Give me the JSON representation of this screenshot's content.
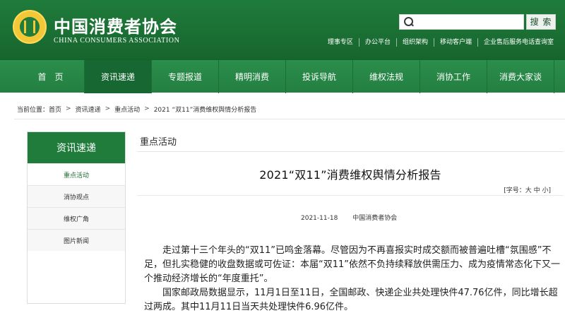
{
  "site": {
    "title": "中国消费者协会",
    "subtitle": "CHINA CONSUMERS ASSOCIATION"
  },
  "search": {
    "placeholder": "",
    "button_label": "搜 索"
  },
  "toplinks": [
    "理事专区",
    "办公平台",
    "组织架构",
    "移动客户端",
    "企业售后服务电话查询室"
  ],
  "nav": [
    {
      "label": "首　页",
      "active": false
    },
    {
      "label": "资讯速递",
      "active": true
    },
    {
      "label": "专题报道",
      "active": false
    },
    {
      "label": "精明消费",
      "active": false
    },
    {
      "label": "投诉导航",
      "active": false
    },
    {
      "label": "维权法规",
      "active": false
    },
    {
      "label": "消协工作",
      "active": false
    },
    {
      "label": "消费大家谈",
      "active": false
    }
  ],
  "breadcrumb": {
    "prefix": "当前位置：",
    "items": [
      "首页",
      "资讯速递",
      "重点活动",
      "2021 “双11”消费维权舆情分析报告"
    ],
    "separator": ">"
  },
  "sidebar": {
    "title": "资讯速递",
    "items": [
      {
        "label": "重点活动",
        "active": true
      },
      {
        "label": "消协观点",
        "active": false
      },
      {
        "label": "维权广角",
        "active": false
      },
      {
        "label": "图片新闻",
        "active": false
      }
    ]
  },
  "article": {
    "section": "重点活动",
    "title": "2021“双11”消费维权舆情分析报告",
    "font_control": "[字号：大 中 小]",
    "date": "2021-11-18",
    "source": "中国消费者协会",
    "paragraphs": [
      "走过第十三个年头的“双11”已鸣金落幕。尽管因为不再喜报实时成交额而被普遍吐槽“氛围感”不足，但扎实稳健的收盘数据或可佐证：本届“双11”依然不负持续释放供需压力、成为疫情常态化下又一个推动经济增长的“年度重托”。",
      "国家邮政局数据显示，11月1日至11日，全国邮政、快递企业共处理快件47.76亿件，同比增长超过两成。其中11月11日当天共处理快件6.96亿件。"
    ]
  },
  "colors": {
    "header_green": "#1f7c3b",
    "nav_green": "#2b8e4b",
    "nav_active": "#166732",
    "logo_gold": "#f2c838"
  },
  "icons": {
    "search": "search-icon",
    "logo": "cca-logo"
  }
}
